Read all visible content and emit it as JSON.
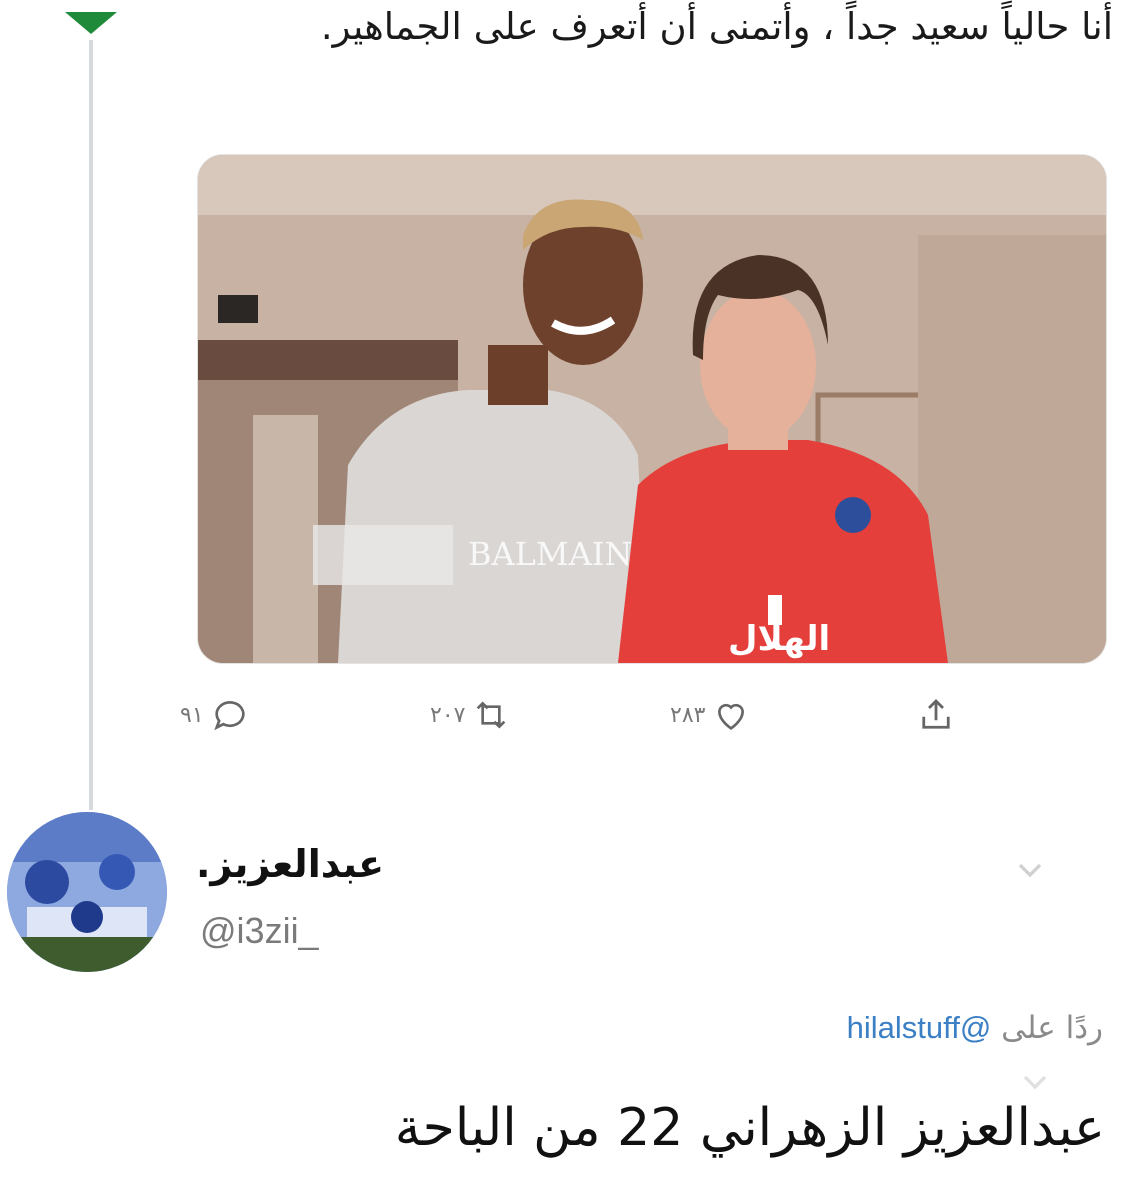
{
  "thread": {
    "tweet_text": "أنا حالياً سعيد جداً ، وأتمنى أن أتعرف على الجماهير.",
    "photo": {
      "description_icon": "photo-icon",
      "shirt_text": "BALMAIN"
    },
    "actions": {
      "reply_count": "٩١",
      "retweet_count": "٢٠٧",
      "like_count": "٢٨٣"
    }
  },
  "reply_tweet": {
    "user_name": "عبدالعزيز.",
    "user_handle": "@i3zii_",
    "replying_prefix": "ردًا على",
    "replying_to": "@hilalstuff",
    "body": "عبدالعزيز الزهراني 22 من الباحة"
  },
  "colors": {
    "caret": "#1f8a3a",
    "link": "#3b7fc4",
    "muted": "#8a8a8a"
  }
}
